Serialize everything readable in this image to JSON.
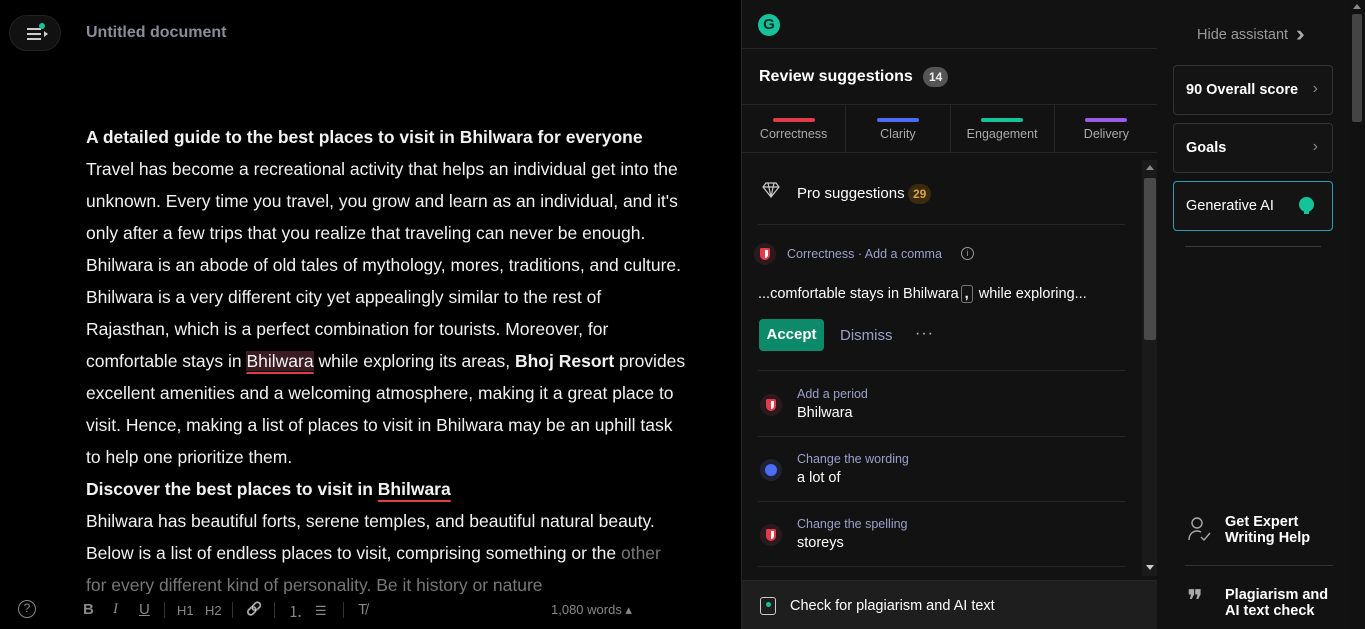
{
  "editor": {
    "title": "Untitled document",
    "heading1": "A detailed guide to the best places to visit in Bhilwara for everyone",
    "para1_part1": "Travel has become a recreational activity that helps an individual get into the unknown. Every time you travel, you grow and learn as an individual, and it's only after a few trips that you realize that traveling can never be enough. Bhilwara is an abode of old tales of mythology, mores, traditions, and culture. Bhilwara is a very different city yet appealingly similar to the rest of Rajasthan, which is a perfect combination for tourists. Moreover, for comfortable stays in ",
    "para1_error": "Bhilwara",
    "para1_part2": " while exploring its areas, ",
    "para1_bold": "Bhoj Resort",
    "para1_part3": " provides excellent amenities and a welcoming atmosphere, making it a great place to visit. Hence, making a list of places to visit in Bhilwara may be an uphill task to help one prioritize them.",
    "heading2_part1": "Discover the best places to visit in ",
    "heading2_error": "Bhilwara",
    "para2": "Bhilwara has beautiful forts, serene temples, and beautiful natural beauty. Below is a list of endless places to visit, comprising something or the",
    "para2_fade": "other for every different kind of personality. Be it history or nature",
    "word_count": "1,080 words ▴",
    "toolbar": {
      "bold": "B",
      "italic": "I",
      "underline": "U",
      "h1": "H1",
      "h2": "H2",
      "link": "🔗",
      "ordered_list": "⒈",
      "bullet_list": "☰",
      "clear_format": "T̸"
    }
  },
  "review": {
    "logo": "G",
    "title": "Review suggestions",
    "count": "14",
    "categories": [
      {
        "label": "Correctness",
        "color": "#e23c4a"
      },
      {
        "label": "Clarity",
        "color": "#4a6cf7"
      },
      {
        "label": "Engagement",
        "color": "#15c39a"
      },
      {
        "label": "Delivery",
        "color": "#9b5de5"
      }
    ],
    "pro": {
      "label": "Pro suggestions",
      "count": "29"
    },
    "active_card": {
      "meta": "Correctness · Add a comma",
      "text_before": "...comfortable stays in Bhilwara",
      "insert": ",",
      "text_after": " while exploring...",
      "accept": "Accept",
      "dismiss": "Dismiss",
      "more": "···"
    },
    "items": [
      {
        "meta": "Add a period",
        "value": "Bhilwara",
        "type": "correctness"
      },
      {
        "meta": "Change the wording",
        "value": "a lot of",
        "type": "clarity"
      },
      {
        "meta": "Change the spelling",
        "value": "storeys",
        "type": "correctness"
      }
    ],
    "plagiarism": "Check for plagiarism and AI text"
  },
  "assistant": {
    "hide": "Hide assistant",
    "overall": "90 Overall score",
    "goals": "Goals",
    "generative": "Generative AI",
    "expert": "Get Expert Writing Help",
    "plagiarism": "Plagiarism and AI text check"
  }
}
